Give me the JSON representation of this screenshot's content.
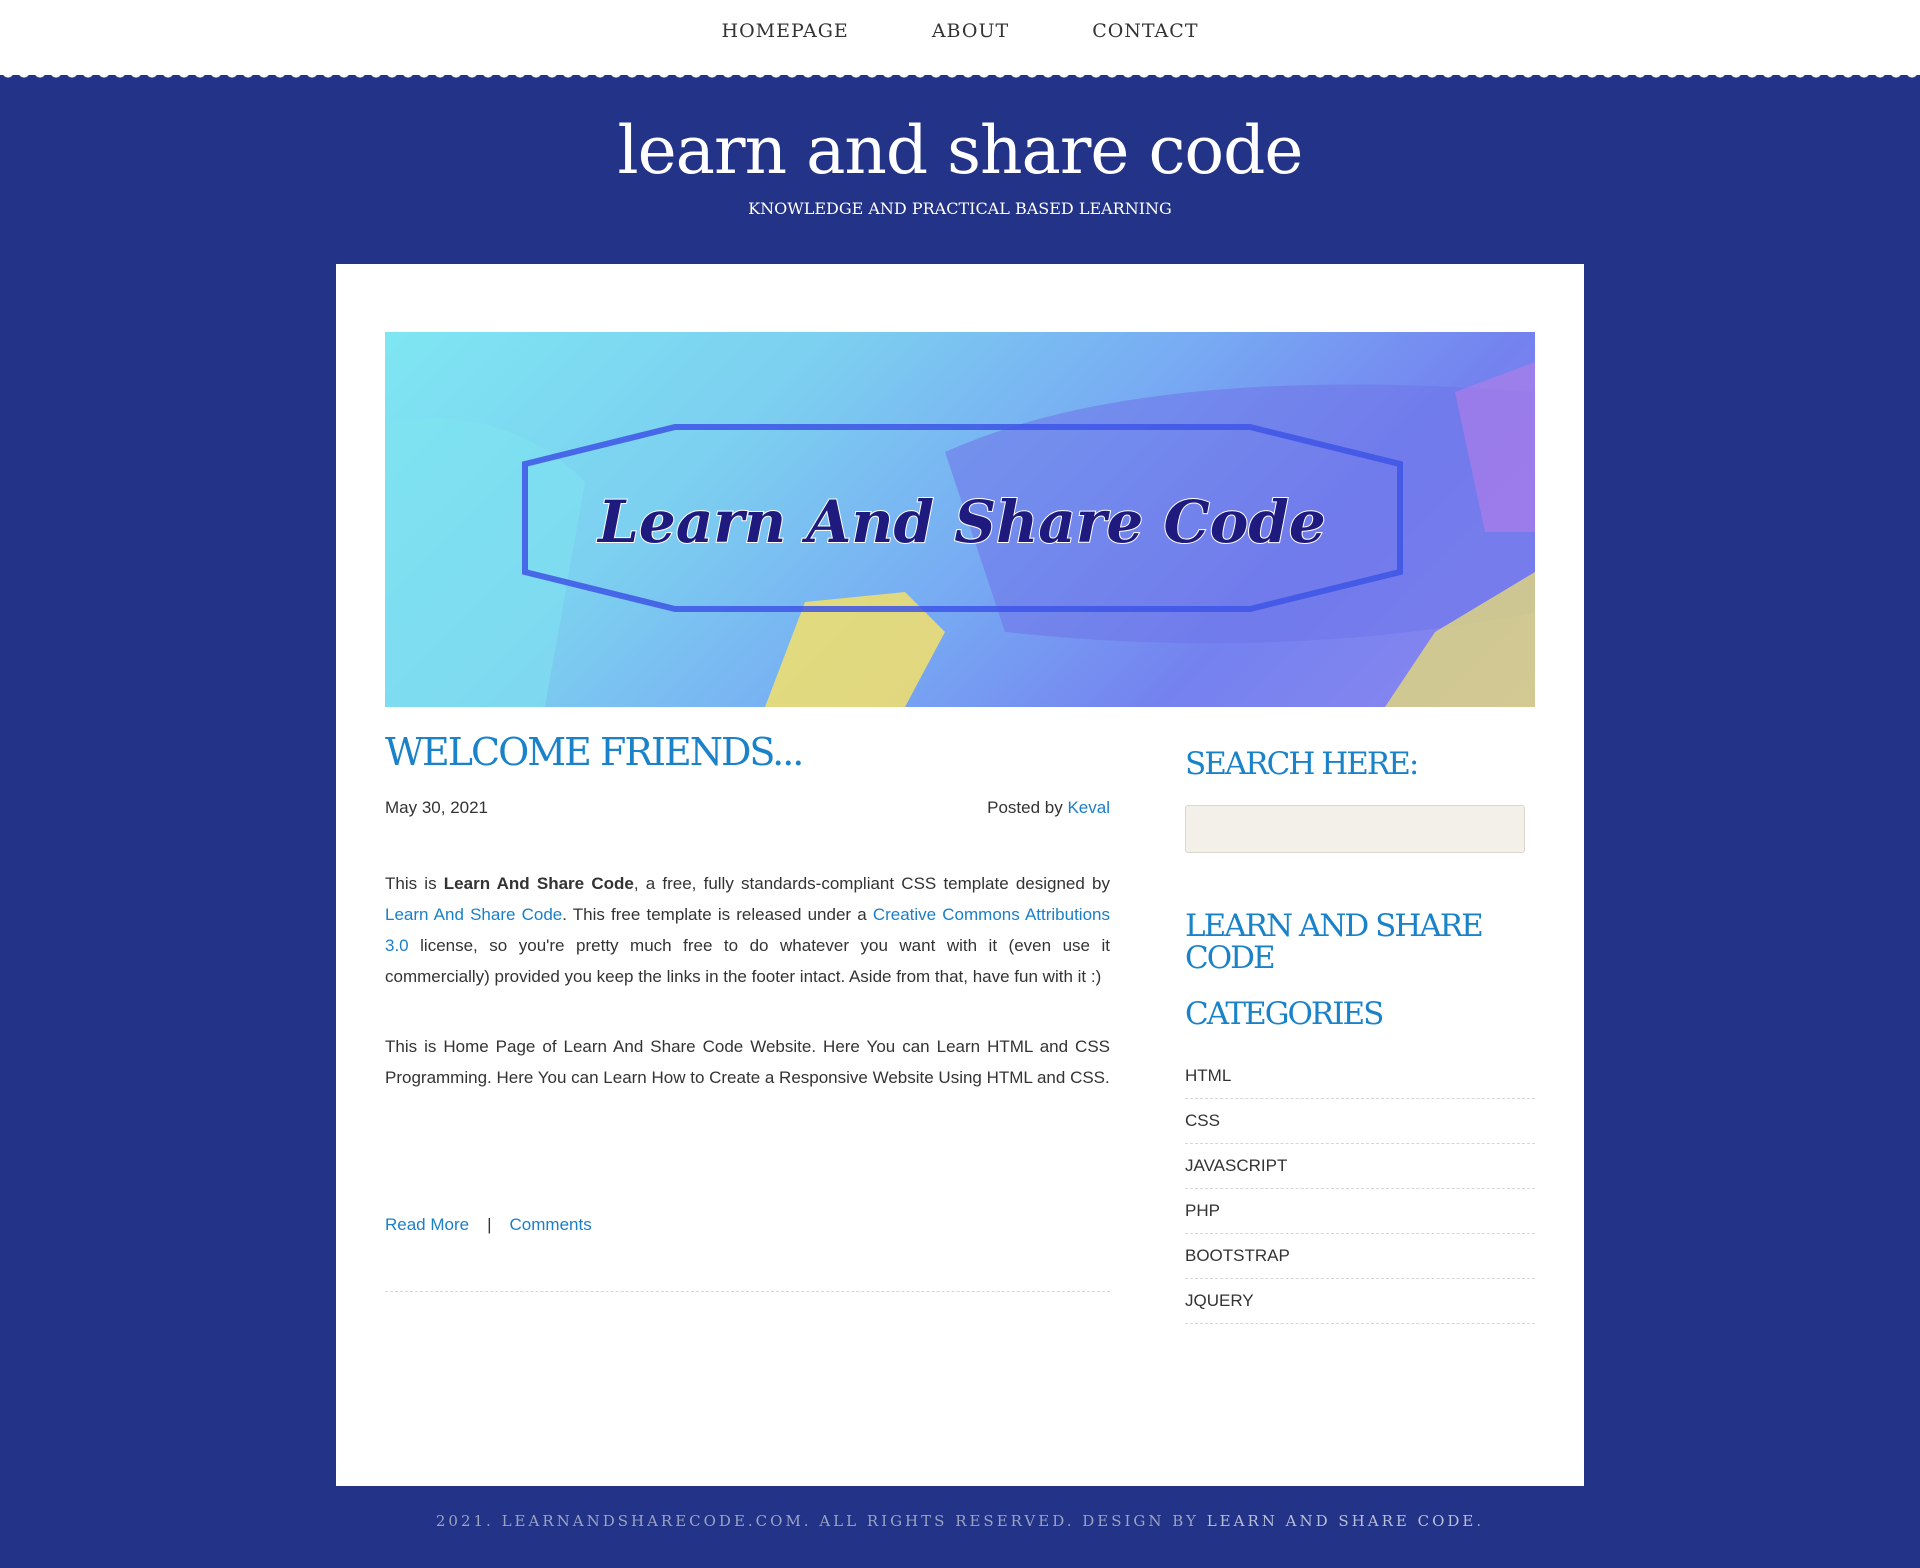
{
  "nav": {
    "items": [
      "HOMEPAGE",
      "ABOUT",
      "CONTACT"
    ]
  },
  "header": {
    "title": "learn and share code",
    "tagline": "KNOWLEDGE AND PRACTICAL BASED LEARNING"
  },
  "banner": {
    "text": "Learn And Share Code"
  },
  "post": {
    "title": "WELCOME FRIENDS...",
    "date": "May 30, 2021",
    "posted_by_label": "Posted by",
    "author": "Keval",
    "p1_a": "This is ",
    "p1_bold": "Learn And Share Code",
    "p1_b": ", a free, fully standards-compliant CSS template designed by ",
    "p1_link1": "Learn And Share Code",
    "p1_c": ". This free template is released under a ",
    "p1_link2": "Creative Commons Attributions 3.0",
    "p1_d": " license, so you're pretty much free to do whatever you want with it (even use it commercially) provided you keep the links in the footer intact. Aside from that, have fun with it :)",
    "p2": "This is Home Page of Learn And Share Code Website. Here You can Learn HTML and CSS Programming. Here You can Learn How to Create a Responsive Website Using HTML and CSS.",
    "read_more": "Read More",
    "separator": "|",
    "comments": "Comments"
  },
  "sidebar": {
    "search_heading": "SEARCH HERE:",
    "site_heading": "LEARN AND SHARE CODE",
    "categories_heading": "CATEGORIES",
    "categories": [
      "HTML",
      "CSS",
      "JAVASCRIPT",
      "PHP",
      "BOOTSTRAP",
      "JQUERY"
    ]
  },
  "footer": {
    "text": "2021. LEARNANDSHARECODE.COM. ALL RIGHTS RESERVED. DESIGN BY ",
    "link": "LEARN AND SHARE CODE",
    "end": "."
  },
  "colors": {
    "page_background": "#233387",
    "accent": "#1a82c9"
  }
}
